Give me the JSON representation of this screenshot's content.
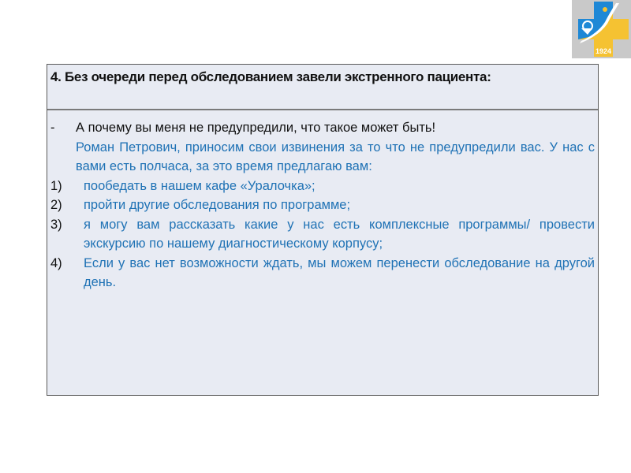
{
  "logo": {
    "name": "hospital-logo",
    "year": "1924",
    "colors": {
      "blue": "#1e88d6",
      "yellow": "#f5c232",
      "background": "#c9c9c9"
    }
  },
  "table": {
    "header": "4. Без очереди перед обследованием завели экстренного пациента:",
    "patient_line": {
      "marker": "-",
      "text": "А почему вы меня не предупредили, что такое может быть!"
    },
    "response_intro": "Роман Петрович, приносим свои извинения за то что не предупредили вас. У нас с вами есть полчаса, за это время предлагаю вам:",
    "options": [
      {
        "marker": "1)",
        "text": "пообедать в нашем кафе «Уралочка»;"
      },
      {
        "marker": "2)",
        "text": "пройти другие обследования по программе;"
      },
      {
        "marker": "3)",
        "text": "я могу вам рассказать какие у нас есть комплексные программы/ провести экскурсию по нашему диагностическому корпусу;"
      },
      {
        "marker": "4)",
        "text": "Если у вас нет возможности ждать, мы можем перенести обследование на другой день."
      }
    ]
  },
  "colors": {
    "response_text": "#1f72b5",
    "cell_background": "#e8ebf3"
  }
}
